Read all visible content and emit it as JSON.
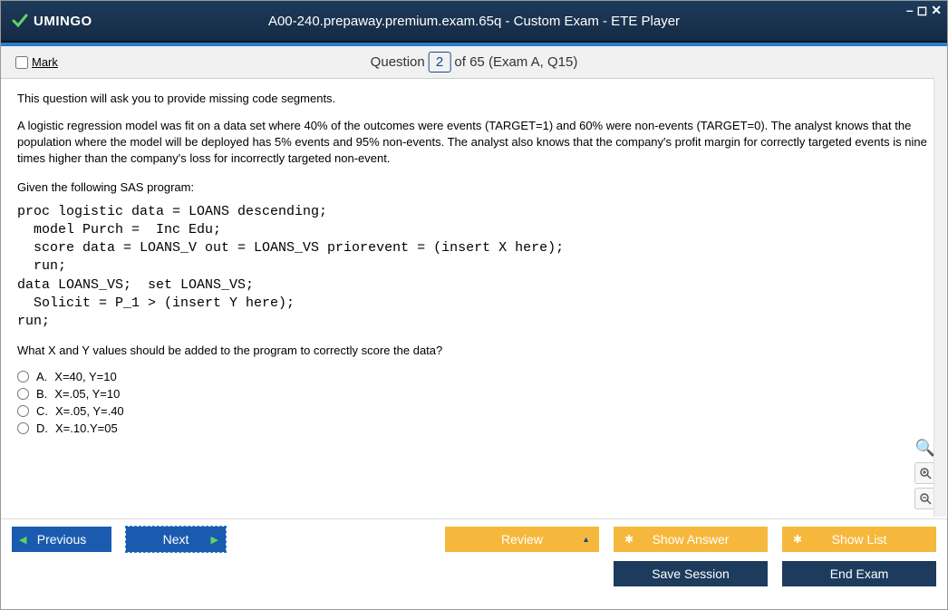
{
  "titlebar": {
    "logo_text": "UMINGO",
    "title": "A00-240.prepaway.premium.exam.65q - Custom Exam - ETE Player"
  },
  "header": {
    "mark_label": "Mark",
    "question_word": "Question",
    "question_num": "2",
    "question_total": "of 65 (Exam A, Q15)"
  },
  "content": {
    "intro": "This question will ask you to provide missing code segments.",
    "body": "A logistic regression model was fit on a data set where 40% of the outcomes were events (TARGET=1) and 60% were non-events (TARGET=0). The analyst knows that the population where the model will be deployed has 5% events and 95% non-events. The analyst also knows that the company's profit margin for correctly targeted events is nine times higher than the company's loss for incorrectly targeted non-event.",
    "given": "Given the following SAS program:",
    "code": "proc logistic data = LOANS descending;\n  model Purch =  Inc Edu;\n  score data = LOANS_V out = LOANS_VS priorevent = (insert X here);\n  run;\ndata LOANS_VS;  set LOANS_VS;\n  Solicit = P_1 > (insert Y here);\nrun;",
    "followup": "What X and Y values should be added to the program to correctly score the data?",
    "options": [
      {
        "letter": "A.",
        "text": "X=40, Y=10"
      },
      {
        "letter": "B.",
        "text": "X=.05, Y=10"
      },
      {
        "letter": "C.",
        "text": "X=.05, Y=.40"
      },
      {
        "letter": "D.",
        "text": "X=.10.Y=05"
      }
    ]
  },
  "footer": {
    "previous": "Previous",
    "next": "Next",
    "review": "Review",
    "show_answer": "Show Answer",
    "show_list": "Show List",
    "save_session": "Save Session",
    "end_exam": "End Exam"
  }
}
